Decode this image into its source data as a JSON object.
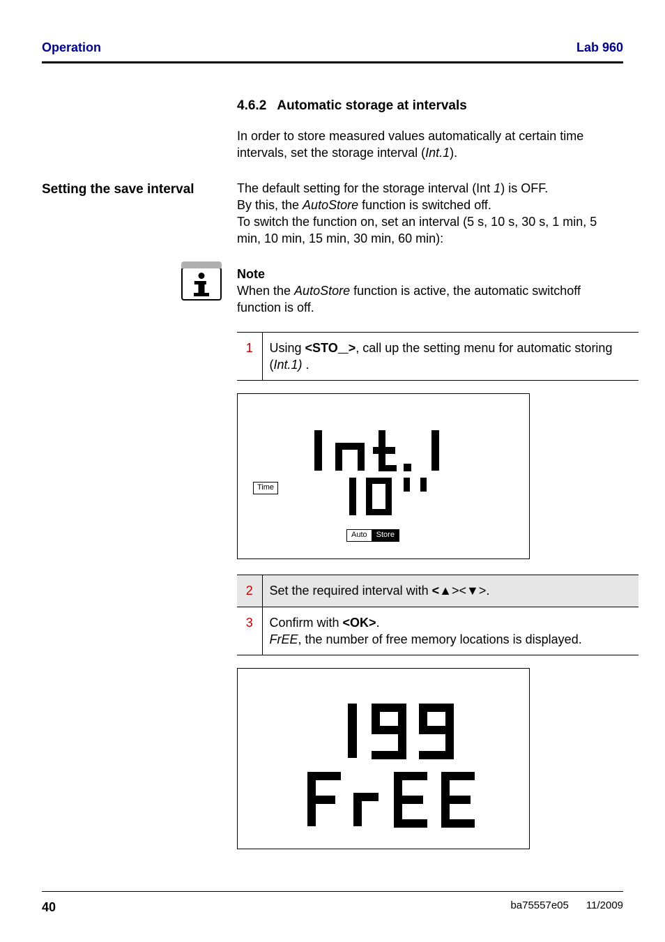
{
  "header": {
    "section": "Operation",
    "model": "Lab 960"
  },
  "heading": {
    "number": "4.6.2",
    "title": "Automatic storage at intervals"
  },
  "intro": "In order to store measured values automatically at certain time intervals, set the storage interval (Int.1).",
  "side_label": "Setting the save interval",
  "save_interval_text": "The default setting for the storage interval (Int 1) is OFF.\nBy this, the AutoStore function is switched off.\nTo switch the function on, set an interval (5 s, 10 s, 30 s, 1 min, 5 min, 10 min, 15 min, 30 min, 60 min):",
  "note": {
    "title": "Note",
    "body": "When the AutoStore function is active, the automatic switchoff function is off."
  },
  "steps": [
    {
      "n": "1",
      "html": "Using <b>&lt;STO__&gt;</b>, call up the setting menu for automatic storing (<span class=\"em\">Int.1)</span> ."
    },
    {
      "n": "2",
      "html": "Set the required interval with <b>&lt;▲&gt;</b>&lt;<b>▼</b>&gt;."
    },
    {
      "n": "3",
      "html": "Confirm with <b>&lt;OK&gt;</b>.<br><span class=\"em\">FrEE</span>, the number of free memory locations is displayed."
    }
  ],
  "lcd1": {
    "top_text": "Int.1",
    "bottom_text": "10i1",
    "time_tag": "Time",
    "auto_tag": "Auto",
    "store_tag": "Store"
  },
  "lcd2": {
    "top_text": "199",
    "bottom_text": "FrEE"
  },
  "footer": {
    "page": "40",
    "doc": "ba75557e05",
    "date": "11/2009"
  }
}
